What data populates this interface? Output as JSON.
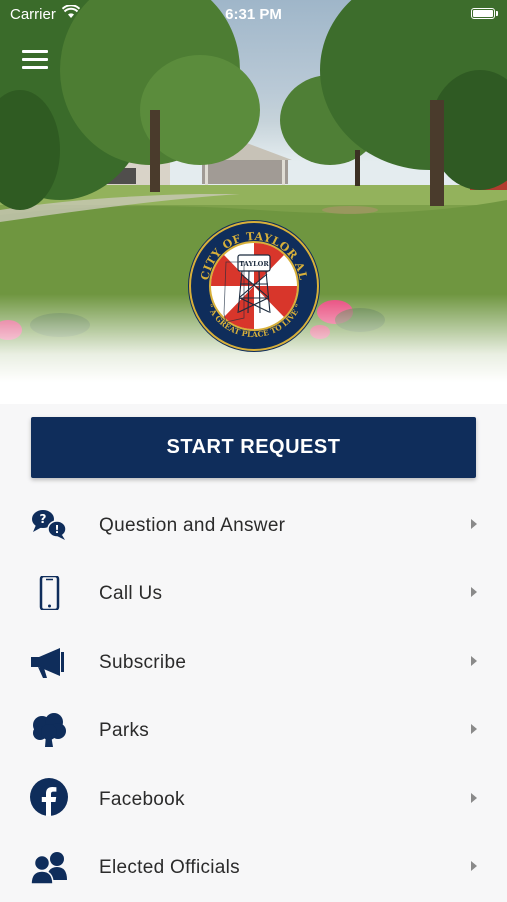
{
  "status_bar": {
    "carrier": "Carrier",
    "time": "6:31 PM"
  },
  "header": {
    "menu_icon": "hamburger-menu-icon",
    "seal": {
      "top_text": "CITY OF TAYLOR AL",
      "tower_text": "TAYLOR",
      "bottom_text": "\" A GREAT PLACE TO LIVE \""
    }
  },
  "start_request": {
    "label": "START REQUEST"
  },
  "menu": [
    {
      "label": "Question and Answer",
      "icon": "question-bubbles-icon"
    },
    {
      "label": "Call Us",
      "icon": "phone-icon"
    },
    {
      "label": "Subscribe",
      "icon": "megaphone-icon"
    },
    {
      "label": "Parks",
      "icon": "tree-icon"
    },
    {
      "label": "Facebook",
      "icon": "facebook-icon"
    },
    {
      "label": "Elected Officials",
      "icon": "people-icon"
    }
  ],
  "colors": {
    "primary": "#0f2d5b",
    "label": "#2b2b2b",
    "chevron": "#8a8a8a"
  }
}
